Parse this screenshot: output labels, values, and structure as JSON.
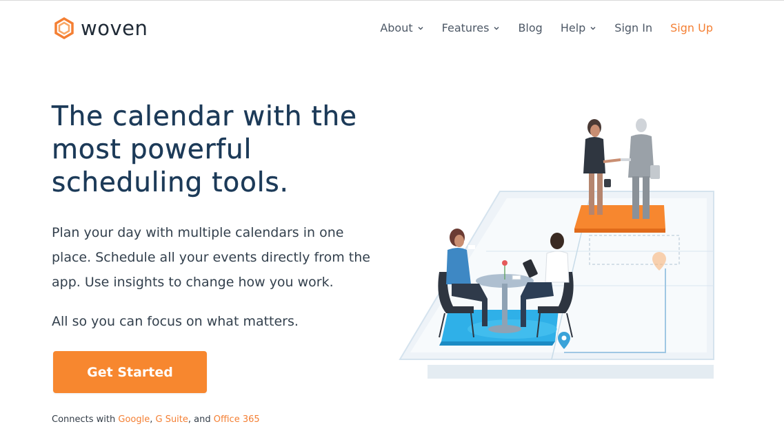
{
  "brand": {
    "name": "woven",
    "accent_color": "#f47f33",
    "heading_color": "#1c3a58"
  },
  "nav": {
    "items": [
      {
        "label": "About",
        "has_dropdown": true
      },
      {
        "label": "Features",
        "has_dropdown": true
      },
      {
        "label": "Blog",
        "has_dropdown": false
      },
      {
        "label": "Help",
        "has_dropdown": true
      },
      {
        "label": "Sign In",
        "has_dropdown": false
      },
      {
        "label": "Sign Up",
        "has_dropdown": false
      }
    ]
  },
  "hero": {
    "title_lines": [
      "The calendar with the",
      "most powerful",
      "scheduling tools."
    ],
    "lead": "Plan your day with multiple calendars in one place. Schedule all your events directly from the app. Use insights to change how you work.",
    "tagline": "All so you can focus on what matters.",
    "cta_label": "Get Started"
  },
  "connects": {
    "prefix": "Connects with ",
    "link1": "Google",
    "sep1": ", ",
    "link2": "G Suite",
    "sep2": ", and ",
    "link3": "Office 365"
  },
  "illustration": {
    "icon": "calendar-meeting-illustration"
  }
}
